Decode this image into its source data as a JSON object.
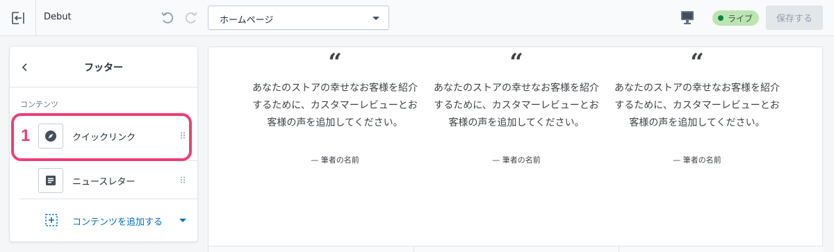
{
  "topbar": {
    "theme_name": "Debut",
    "page_select": {
      "value": "ホームページ"
    },
    "live_badge": "ライブ",
    "save_label": "保存する"
  },
  "sidebar": {
    "title": "フッター",
    "section_heading": "コンテンツ",
    "blocks": [
      {
        "label": "クイックリンク",
        "icon": "compass-icon"
      },
      {
        "label": "ニュースレター",
        "icon": "text-block-icon"
      }
    ],
    "add_content_label": "コンテンツを追加する"
  },
  "annotation": {
    "number": "1",
    "color": "#ee3e74"
  },
  "preview": {
    "testimonials": [
      {
        "quote": "“",
        "text": "あなたのストアの幸せなお客様を紹介するために、カスタマーレビューとお客様の声を追加してください。",
        "author": "— 筆者の名前"
      },
      {
        "quote": "“",
        "text": "あなたのストアの幸せなお客様を紹介するために、カスタマーレビューとお客様の声を追加してください。",
        "author": "— 筆者の名前"
      },
      {
        "quote": "“",
        "text": "あなたのストアの幸せなお客様を紹介するために、カスタマーレビューとお客様の声を追加してください。",
        "author": "— 筆者の名前"
      }
    ]
  },
  "colors": {
    "accent": "#006fbb",
    "live_badge": "#bbe5b3",
    "live_dot": "#108043",
    "highlight": "#ee3e74"
  }
}
